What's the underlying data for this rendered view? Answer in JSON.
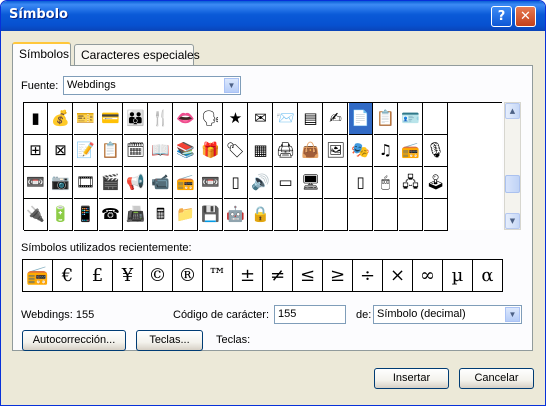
{
  "window": {
    "title": "Símbolo",
    "help_glyph": "?",
    "close_glyph": "✕"
  },
  "tabs": [
    {
      "label": "Símbolos",
      "selected": true
    },
    {
      "label": "Caracteres especiales",
      "selected": false
    }
  ],
  "font": {
    "label": "Fuente:",
    "value": "Webdings"
  },
  "symbol_grid": {
    "columns": 19,
    "selected_index": 13,
    "icons": [
      "battery-icon",
      "money-bag-icon",
      "ticket-icon",
      "credit-card-icon",
      "family-icon",
      "knife-fork-icon",
      "lips-icon",
      "talking-head-icon",
      "star-icon",
      "envelope-icon",
      "mail-fast-icon",
      "form-icon",
      "signature-icon",
      "document-icon",
      "doc-list-icon",
      "id-badge-icon",
      "scroll-up-icon",
      "rider-icon",
      "car-crash-icon",
      "window-icon",
      "picture-frame-icon",
      "pencil-note-icon",
      "clipboard-icon",
      "calendar-icon",
      "open-book-icon",
      "stack-books-icon",
      "gift-icon",
      "tag-icon",
      "spreadsheet-icon",
      "printer-icon",
      "bag-icon",
      "photo-frame-icon",
      "masks-icon",
      "music-note-icon",
      "radio-icon",
      "microphone-icon",
      "headphones-icon",
      "cd-icon",
      "tape-icon",
      "camera-icon",
      "film-strip-icon",
      "clapper-icon",
      "megaphone-icon",
      "video-camera-icon",
      "boombox-icon",
      "vcr-icon",
      "slider-icon",
      "speaker-icon",
      "monitor-icon",
      "computer-icon",
      "scroll-track",
      "phone-icon",
      "mouse-icon",
      "network-icon",
      "joystick-icon",
      "gamepad-icon",
      "handset-icon",
      "plug-icon",
      "battery-charger-icon",
      "mobile-phone-icon",
      "desk-phone-icon",
      "fax-icon",
      "calculator-icon",
      "folder-icon",
      "floppy-disk-icon",
      "robot-icon",
      "lock-icon",
      "scroll-down-icon"
    ],
    "glyphs": [
      "▮",
      "💰",
      "🎫",
      "💳",
      "👪",
      "🍴",
      "👄",
      "🗣",
      "★",
      "✉",
      "📨",
      "▤",
      "✍",
      "📄",
      "📋",
      "🪪",
      "",
      "🏇",
      "🚗",
      "⊞",
      "⊠",
      "📝",
      "📋",
      "🗓",
      "📖",
      "📚",
      "🎁",
      "🏷",
      "▦",
      "🖨",
      "👜",
      "🖼",
      "🎭",
      "♫",
      "📻",
      "🎙",
      "🎧",
      "💿",
      "📼",
      "📷",
      "🎞",
      "🎬",
      "📢",
      "📹",
      "📻",
      "📼",
      "▯",
      "🔊",
      "▭",
      "🖥",
      "",
      "▯",
      "🖱",
      "🖧",
      "🕹",
      "🎮",
      "📞",
      "🔌",
      "🔋",
      "📱",
      "☎",
      "📠",
      "🖩",
      "📁",
      "💾",
      "🤖",
      "🔒",
      ""
    ]
  },
  "recent": {
    "label": "Símbolos utilizados recientemente:",
    "symbols": [
      "📻",
      "€",
      "£",
      "¥",
      "©",
      "®",
      "™",
      "±",
      "≠",
      "≤",
      "≥",
      "÷",
      "×",
      "∞",
      "µ",
      "α"
    ]
  },
  "char_info": {
    "name": "Webdings: 155",
    "code_label": "Código de carácter:",
    "code_value": "155",
    "from_label": "de:",
    "from_value": "Símbolo (decimal)"
  },
  "buttons": {
    "autocorrect": "Autocorrección...",
    "shortcut": "Teclas...",
    "keys_label": "Teclas:",
    "insert": "Insertar",
    "cancel": "Cancelar"
  }
}
